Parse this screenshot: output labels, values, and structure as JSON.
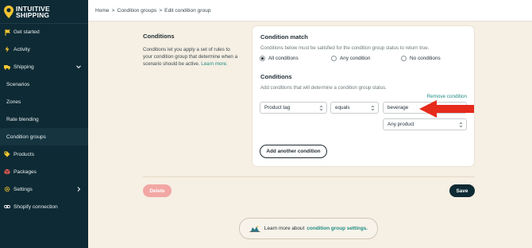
{
  "brand": {
    "line1": "INTUITIVE",
    "line2": "SHIPPING"
  },
  "sidebar": {
    "items": [
      {
        "label": "Get started",
        "icon": "flag-icon"
      },
      {
        "label": "Activity",
        "icon": "lightning-icon"
      },
      {
        "label": "Shipping",
        "icon": "truck-icon",
        "expanded": true
      },
      {
        "label": "Scenarios"
      },
      {
        "label": "Zones"
      },
      {
        "label": "Rate blending"
      },
      {
        "label": "Condition groups"
      },
      {
        "label": "Products",
        "icon": "tag-icon"
      },
      {
        "label": "Packages",
        "icon": "box-icon"
      },
      {
        "label": "Settings",
        "icon": "gear-icon"
      },
      {
        "label": "Shopify connection",
        "icon": "link-icon"
      }
    ]
  },
  "breadcrumb": {
    "home": "Home",
    "sep": ">",
    "parent": "Condition groups",
    "current": "Edit condition group"
  },
  "left": {
    "title": "Conditions",
    "description": "Conditions let you apply a set of rules to your condition group that determine when a scenario should be active.",
    "learn_more": "Learn more."
  },
  "card": {
    "match_title": "Condition match",
    "match_sub": "Conditions below must be satisfied for the condition group status to return true.",
    "radios": [
      {
        "label": "All conditions",
        "checked": true
      },
      {
        "label": "Any condition",
        "checked": false
      },
      {
        "label": "No conditions",
        "checked": false
      }
    ],
    "conditions_title": "Conditions",
    "conditions_sub": "Add conditions that will determine a condition group status.",
    "remove_label": "Remove condition",
    "field_value": "Product tag",
    "operator_value": "equals",
    "text_value": "beverage",
    "scope_value": "Any product",
    "add_label": "Add another condition"
  },
  "actions": {
    "delete": "Delete",
    "save": "Save"
  },
  "learn": {
    "prefix": "Learn more about",
    "link": "condition group settings."
  },
  "colors": {
    "sidebar": "#0e2a34",
    "accent": "#1f8c83",
    "delete": "#f2a7a4",
    "arrow": "#e62a1c"
  }
}
